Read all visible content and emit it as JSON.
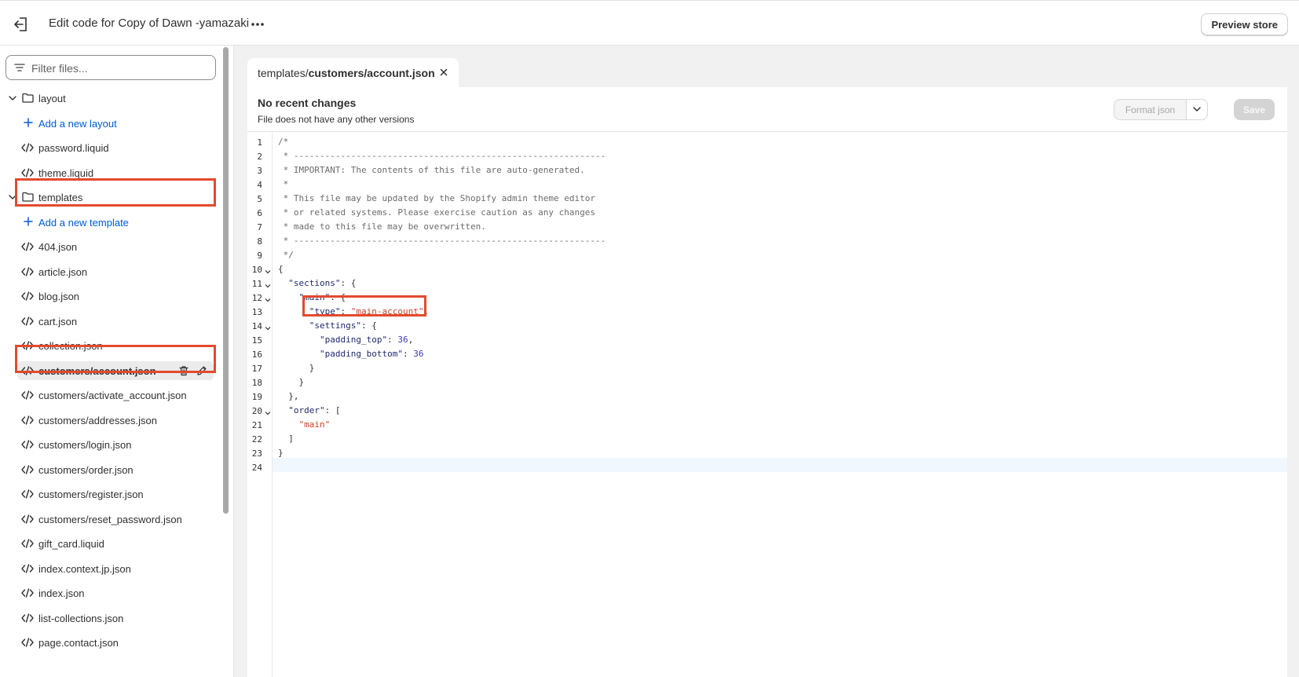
{
  "topbar": {
    "title": "Edit code for Copy of Dawn -yamazaki",
    "preview_label": "Preview store"
  },
  "sidebar": {
    "filter_placeholder": "Filter files...",
    "layout_folder": "layout",
    "add_layout": "Add a new layout",
    "layout_files": [
      "password.liquid",
      "theme.liquid"
    ],
    "templates_folder": "templates",
    "add_template": "Add a new template",
    "template_files": [
      "404.json",
      "article.json",
      "blog.json",
      "cart.json",
      "collection.json",
      "customers/account.json",
      "customers/activate_account.json",
      "customers/addresses.json",
      "customers/login.json",
      "customers/order.json",
      "customers/register.json",
      "customers/reset_password.json",
      "gift_card.liquid",
      "index.context.jp.json",
      "index.json",
      "list-collections.json",
      "page.contact.json"
    ]
  },
  "editor": {
    "tab_prefix": "templates/",
    "tab_file": "customers/account.json",
    "status_title": "No recent changes",
    "status_sub": "File does not have any other versions",
    "format_label": "Format json",
    "save_label": "Save",
    "lines": [
      "/*",
      " * ------------------------------------------------------------",
      " * IMPORTANT: The contents of this file are auto-generated.",
      " *",
      " * This file may be updated by the Shopify admin theme editor",
      " * or related systems. Please exercise caution as any changes",
      " * made to this file may be overwritten.",
      " * ------------------------------------------------------------",
      " */",
      "{",
      "  \"sections\": {",
      "    \"main\": {",
      "      \"type\": \"main-account\",",
      "      \"settings\": {",
      "        \"padding_top\": 36,",
      "        \"padding_bottom\": 36",
      "      }",
      "    }",
      "  },",
      "  \"order\": [",
      "    \"main\"",
      "  ]",
      "}",
      ""
    ]
  },
  "colors": {
    "highlight": "#e34a2e",
    "link": "#005bd3",
    "string": "#c9432a",
    "key": "#1f2a6d"
  }
}
